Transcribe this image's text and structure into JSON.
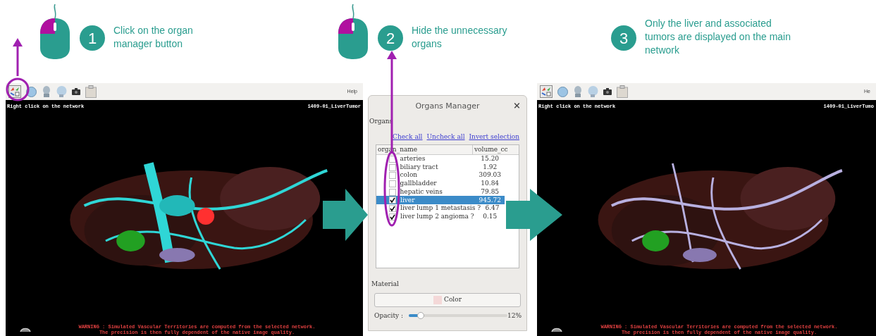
{
  "steps": [
    {
      "number": "1",
      "text": "Click on the organ manager button",
      "mouse": true
    },
    {
      "number": "2",
      "text": "Hide the unnecessary organs",
      "mouse": true
    },
    {
      "number": "3",
      "text": "Only the liver and associated tumors are displayed on the main network",
      "mouse": false
    }
  ],
  "viewers": [
    {
      "help": "Help",
      "status": "Right click on the network",
      "case_name": "1409-01_LiverTumor",
      "warning": [
        "WARNING : Simulated Vascular Territories are computed from the selected network.",
        "The precision is then fully dependent of the native image quality."
      ]
    },
    {
      "help": "He",
      "status": "Right click on the network",
      "case_name": "1409-01_LiverTumo",
      "warning": [
        "WARNING : Simulated Vascular Territories are computed from the selected network.",
        "The precision is then fully dependent of the native image quality."
      ]
    }
  ],
  "dialog": {
    "title": "Organs Manager",
    "close": "×",
    "group": "Organs",
    "links": [
      "Check all",
      "Uncheck all",
      "Invert selection"
    ],
    "columns": [
      "organ_name",
      "volume_cc"
    ],
    "rows": [
      {
        "name": "arteries",
        "volume": "15.20",
        "checked": false,
        "selected": false
      },
      {
        "name": "biliary tract",
        "volume": "1.92",
        "checked": false,
        "selected": false
      },
      {
        "name": "colon",
        "volume": "309.03",
        "checked": false,
        "selected": false
      },
      {
        "name": "gallbladder",
        "volume": "10.84",
        "checked": false,
        "selected": false
      },
      {
        "name": "hepatic veins",
        "volume": "79.85",
        "checked": false,
        "selected": false
      },
      {
        "name": "liver",
        "volume": "945.72",
        "checked": true,
        "selected": true
      },
      {
        "name": "liver lump 1 metastasis ?",
        "volume": "6.47",
        "checked": true,
        "selected": false
      },
      {
        "name": "liver lump 2 angioma ?",
        "volume": "0.15",
        "checked": true,
        "selected": false
      }
    ],
    "material": "Material",
    "color_button": "Color",
    "opacity_label": "Opacity :",
    "opacity": {
      "level": 0.12
    },
    "opacity_reading": "12%"
  }
}
